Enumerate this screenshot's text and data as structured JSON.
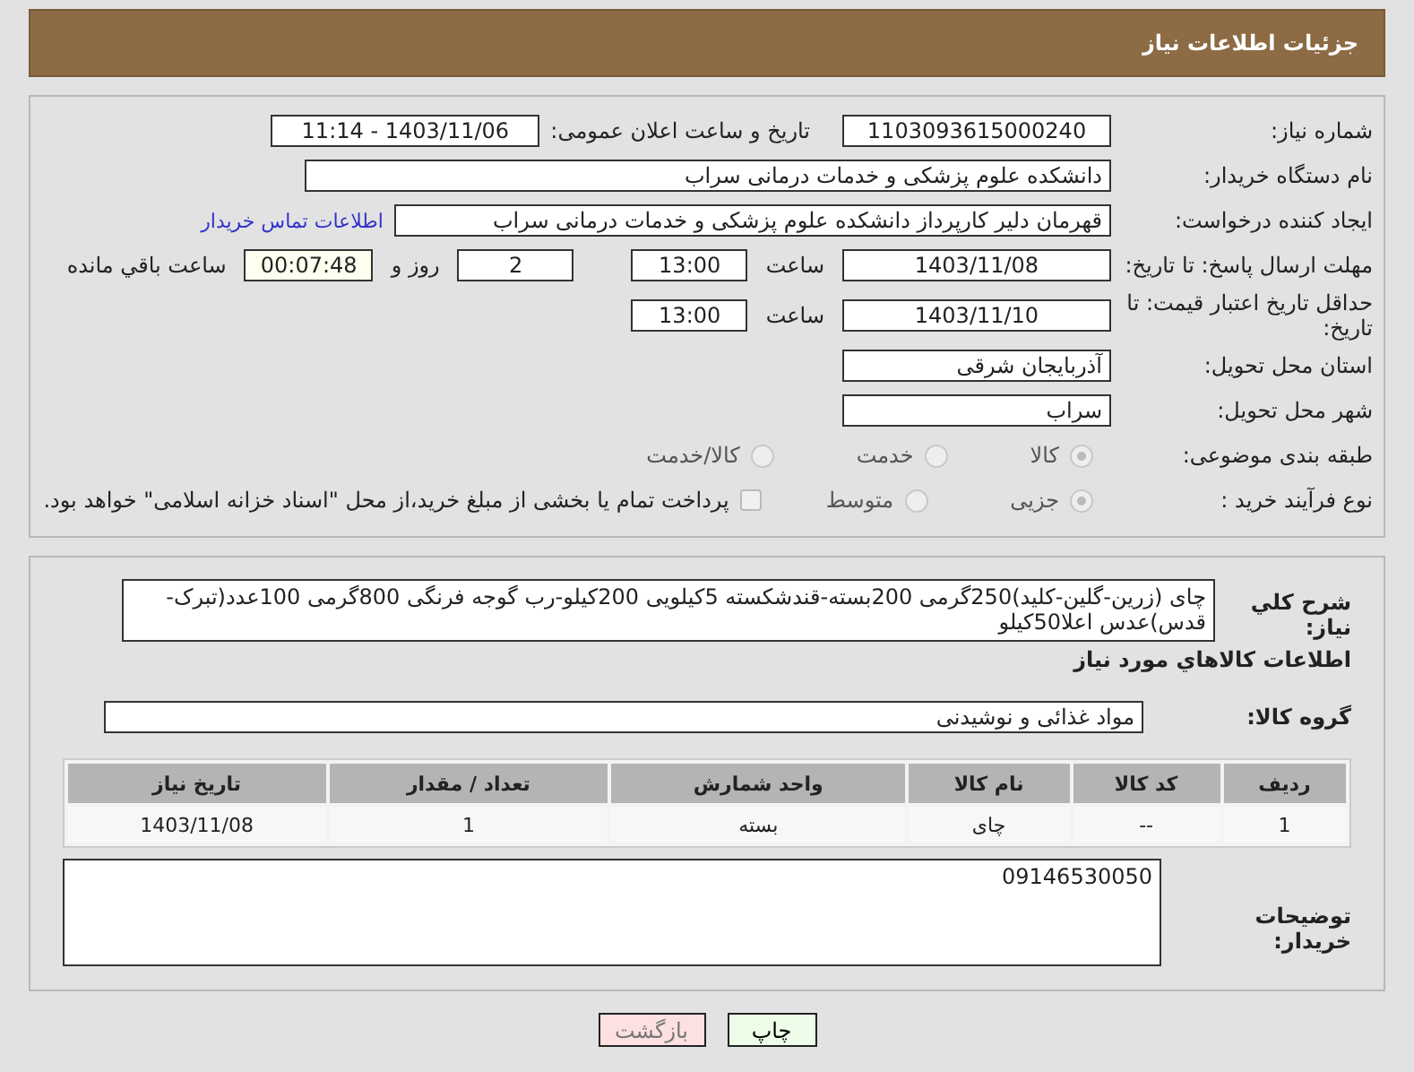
{
  "header": {
    "title": "جزئیات اطلاعات نیاز"
  },
  "form": {
    "need_number": {
      "label": "شماره نیاز:",
      "value": "1103093615000240"
    },
    "announce": {
      "label": "تاریخ و ساعت اعلان عمومی:",
      "value": "1403/11/06 - 11:14"
    },
    "buyer_org": {
      "label": "نام دستگاه خریدار:",
      "value": "دانشکده علوم پزشکی و خدمات درمانی سراب"
    },
    "requester": {
      "label": "ایجاد کننده درخواست:",
      "value": "قهرمان دلیر کارپرداز دانشکده علوم پزشکی و خدمات درمانی سراب",
      "link": "اطلاعات تماس خریدار"
    },
    "deadline": {
      "label": "مهلت ارسال پاسخ: تا تاریخ:",
      "date": "1403/11/08",
      "time_label": "ساعت",
      "time": "13:00",
      "days": "2",
      "days_label": "روز و",
      "remaining": "00:07:48",
      "remaining_label": "ساعت باقي مانده"
    },
    "validity": {
      "label": "حداقل تاریخ اعتبار قیمت: تا تاریخ:",
      "date": "1403/11/10",
      "time_label": "ساعت",
      "time": "13:00"
    },
    "province": {
      "label": "استان محل تحویل:",
      "value": "آذربایجان شرقی"
    },
    "city": {
      "label": "شهر محل تحویل:",
      "value": "سراب"
    },
    "category": {
      "label": "طبقه بندی موضوعی:",
      "options": [
        {
          "label": "کالا",
          "selected": true
        },
        {
          "label": "خدمت",
          "selected": false
        },
        {
          "label": "کالا/خدمت",
          "selected": false
        }
      ]
    },
    "process": {
      "label": "نوع فرآیند خرید :",
      "options": [
        {
          "label": "جزیی",
          "selected": true
        },
        {
          "label": "متوسط",
          "selected": false
        }
      ],
      "treasury": {
        "label": "پرداخت تمام یا بخشی از مبلغ خرید،از محل \"اسناد خزانه اسلامی\" خواهد بود.",
        "checked": false
      }
    }
  },
  "details": {
    "description": {
      "label": "شرح کلي نياز:",
      "value": "چای (زرین-گلین-کلید)250گرمی 200بسته-قندشکسته 5کیلویی 200کیلو-رب گوجه فرنگی 800گرمی 100عدد(تبرک-قدس)عدس اعلا50کیلو"
    },
    "goods_heading": "اطلاعات کالاهاي مورد نياز",
    "goods_group": {
      "label": "گروه کالا:",
      "value": "مواد غذائی و نوشیدنی"
    },
    "table": {
      "columns": [
        "ردیف",
        "کد کالا",
        "نام کالا",
        "واحد شمارش",
        "تعداد / مقدار",
        "تاریخ نیاز"
      ],
      "rows": [
        [
          "1",
          "--",
          "چای",
          "بسته",
          "1",
          "1403/11/08"
        ]
      ]
    },
    "buyer_notes": {
      "label": "توضیحات خریدار:",
      "value": "09146530050"
    }
  },
  "buttons": [
    {
      "label": "چاپ",
      "kind": "print"
    },
    {
      "label": "بازگشت",
      "kind": "back"
    }
  ]
}
